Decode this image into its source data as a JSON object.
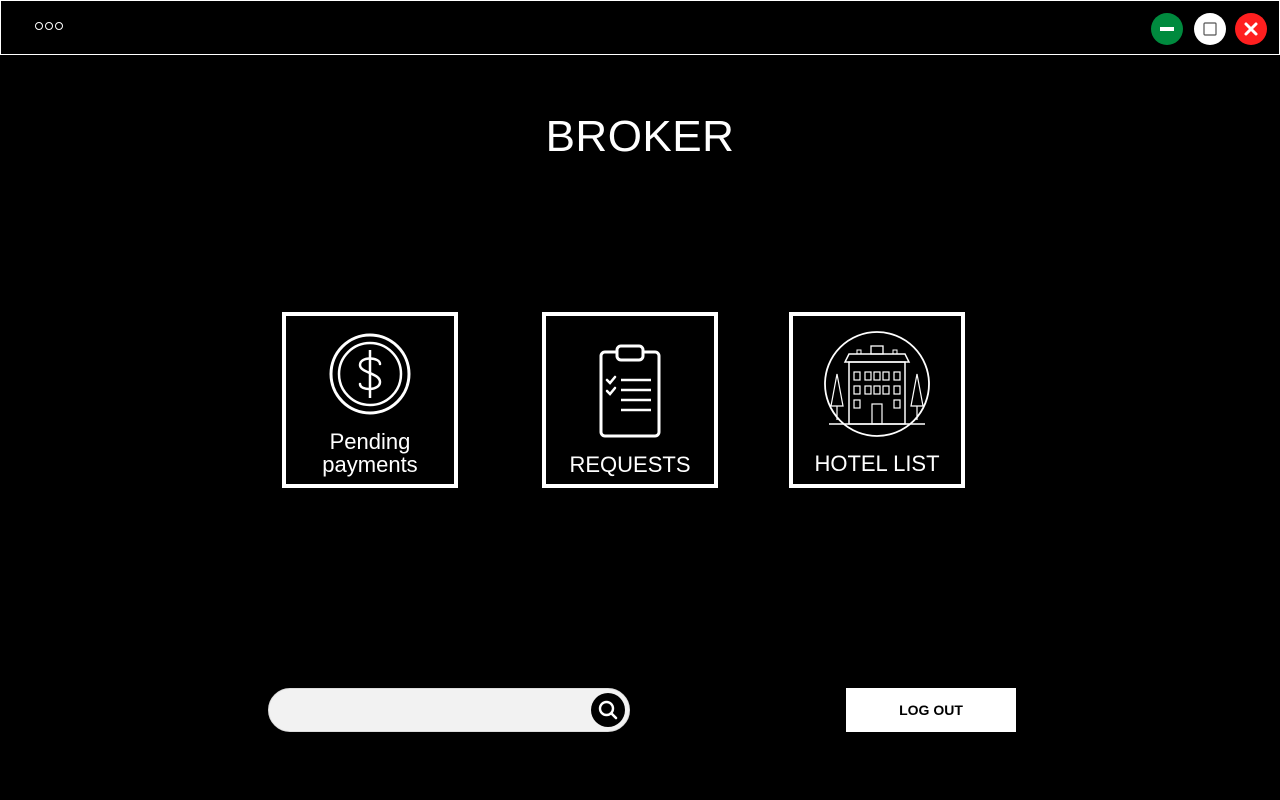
{
  "window": {
    "menu_icon": "more-dots-icon",
    "minimize_icon": "minimize-icon",
    "maximize_icon": "maximize-icon",
    "close_icon": "close-icon",
    "colors": {
      "minimize": "#008a3e",
      "maximize": "#ffffff",
      "close": "#ff1f1f"
    }
  },
  "page": {
    "title": "BROKER"
  },
  "tiles": [
    {
      "label_line1": "Pending",
      "label_line2": "payments",
      "icon": "dollar-coin-icon"
    },
    {
      "label": "REQUESTS",
      "icon": "clipboard-checklist-icon"
    },
    {
      "label": "HOTEL LIST",
      "icon": "hotel-building-icon"
    }
  ],
  "search": {
    "value": "",
    "placeholder": "",
    "icon": "search-icon"
  },
  "logout": {
    "label": "LOG OUT"
  },
  "colors": {
    "background": "#000000",
    "foreground": "#ffffff",
    "search_field": "#f2f2f2"
  }
}
